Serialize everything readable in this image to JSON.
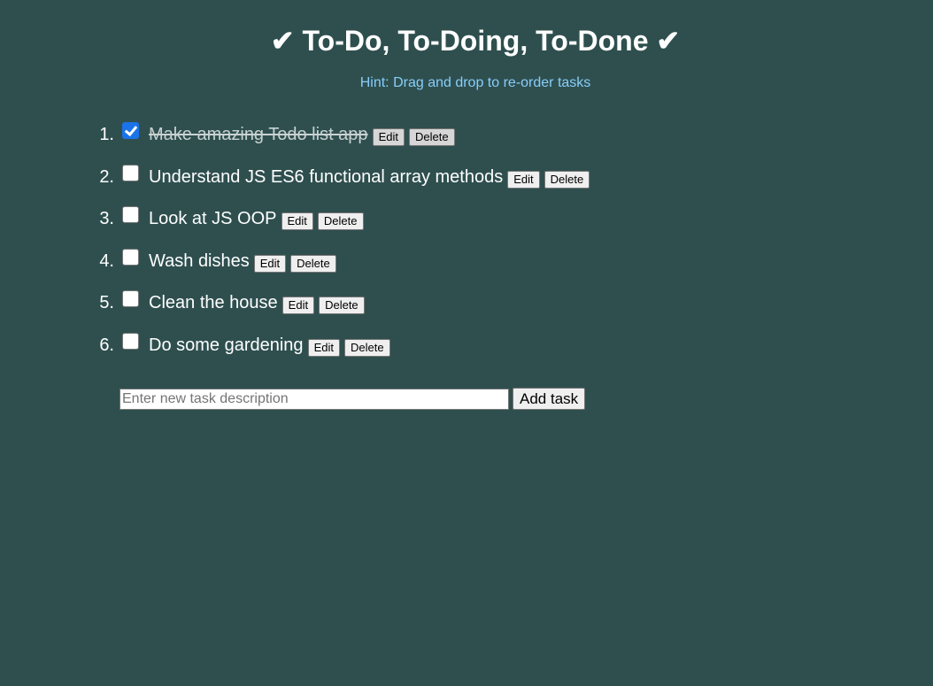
{
  "header": {
    "title": "✔ To-Do, To-Doing, To-Done ✔",
    "hint": "Hint: Drag and drop to re-order tasks"
  },
  "tasks": [
    {
      "number": "1.",
      "text": "Make amazing Todo list app",
      "done": true,
      "edit_label": "Edit",
      "delete_label": "Delete"
    },
    {
      "number": "2.",
      "text": "Understand JS ES6 functional array methods",
      "done": false,
      "edit_label": "Edit",
      "delete_label": "Delete"
    },
    {
      "number": "3.",
      "text": "Look at JS OOP",
      "done": false,
      "edit_label": "Edit",
      "delete_label": "Delete"
    },
    {
      "number": "4.",
      "text": "Wash dishes",
      "done": false,
      "edit_label": "Edit",
      "delete_label": "Delete"
    },
    {
      "number": "5.",
      "text": "Clean the house",
      "done": false,
      "edit_label": "Edit",
      "delete_label": "Delete"
    },
    {
      "number": "6.",
      "text": "Do some gardening",
      "done": false,
      "edit_label": "Edit",
      "delete_label": "Delete"
    }
  ],
  "new_task": {
    "value": "",
    "placeholder": "Enter new task description",
    "add_label": "Add task"
  },
  "colors": {
    "background": "#2f4f4f",
    "hint": "#87cefa",
    "checkbox_checked": "#1a73e8"
  }
}
